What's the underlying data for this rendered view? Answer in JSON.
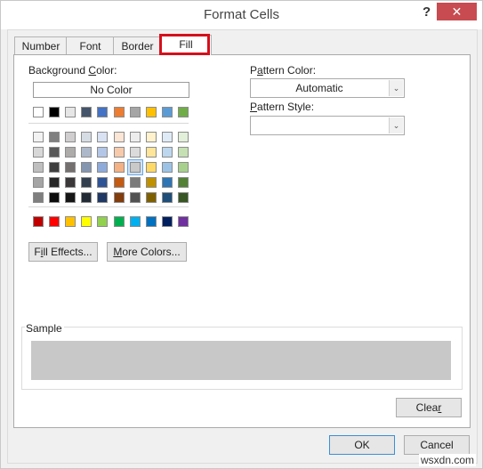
{
  "window": {
    "title": "Format Cells",
    "help_label": "?",
    "close_label": "✕"
  },
  "tabs": [
    {
      "label": "Number",
      "active": false
    },
    {
      "label": "Font",
      "active": false
    },
    {
      "label": "Border",
      "active": false
    },
    {
      "label": "Fill",
      "active": true
    }
  ],
  "fill": {
    "background_color_label_pre": "Background ",
    "background_color_label_ul": "C",
    "background_color_label_post": "olor:",
    "no_color_label": "No Color",
    "theme_row": [
      "#ffffff",
      "#000000",
      "#e7e6e6",
      "#44546a",
      "#4472c4",
      "#ed7d31",
      "#a5a5a5",
      "#ffc000",
      "#5b9bd5",
      "#70ad47"
    ],
    "shade_rows": [
      [
        "#f2f2f2",
        "#808080",
        "#d0cece",
        "#d6dce4",
        "#d9e2f3",
        "#fbe5d5",
        "#ededed",
        "#fff2cc",
        "#deebf6",
        "#e2efd9"
      ],
      [
        "#d8d8d8",
        "#595959",
        "#aeabab",
        "#adb9ca",
        "#b4c6e7",
        "#f7caac",
        "#dbdbdb",
        "#fee599",
        "#bdd7ee",
        "#c5e0b3"
      ],
      [
        "#bfbfbf",
        "#3f3f3f",
        "#757070",
        "#8496b0",
        "#8eaadb",
        "#f4b183",
        "#c9c9c9",
        "#ffd966",
        "#9cc3e5",
        "#a8d08d"
      ],
      [
        "#a5a5a5",
        "#262626",
        "#3a3838",
        "#323f4f",
        "#2f5496",
        "#c55a11",
        "#7b7b7b",
        "#bf9000",
        "#2e75b5",
        "#538135"
      ],
      [
        "#7f7f7f",
        "#0c0c0c",
        "#171616",
        "#222a35",
        "#1f3864",
        "#833c0b",
        "#525252",
        "#7f6000",
        "#1e4e79",
        "#375623"
      ]
    ],
    "selected_swatch": {
      "row": 2,
      "col": 6
    },
    "standard_row": [
      "#c00000",
      "#ff0000",
      "#ffc000",
      "#ffff00",
      "#92d050",
      "#00b050",
      "#00b0f0",
      "#0070c0",
      "#002060",
      "#7030a0"
    ],
    "fill_effects_pre": "F",
    "fill_effects_ul": "i",
    "fill_effects_post": "ll Effects...",
    "more_colors_ul": "M",
    "more_colors_post": "ore Colors...",
    "pattern_color_pre": "P",
    "pattern_color_ul": "a",
    "pattern_color_post": "ttern Color:",
    "pattern_color_value": "Automatic",
    "pattern_style_ul": "P",
    "pattern_style_post": "attern Style:",
    "pattern_style_value": "",
    "sample_label": "Sample",
    "sample_color": "#c8c8c8",
    "clear_pre": "Clea",
    "clear_ul": "r"
  },
  "footer": {
    "ok_label": "OK",
    "cancel_label": "Cancel"
  },
  "watermark": "wsxdn.com"
}
